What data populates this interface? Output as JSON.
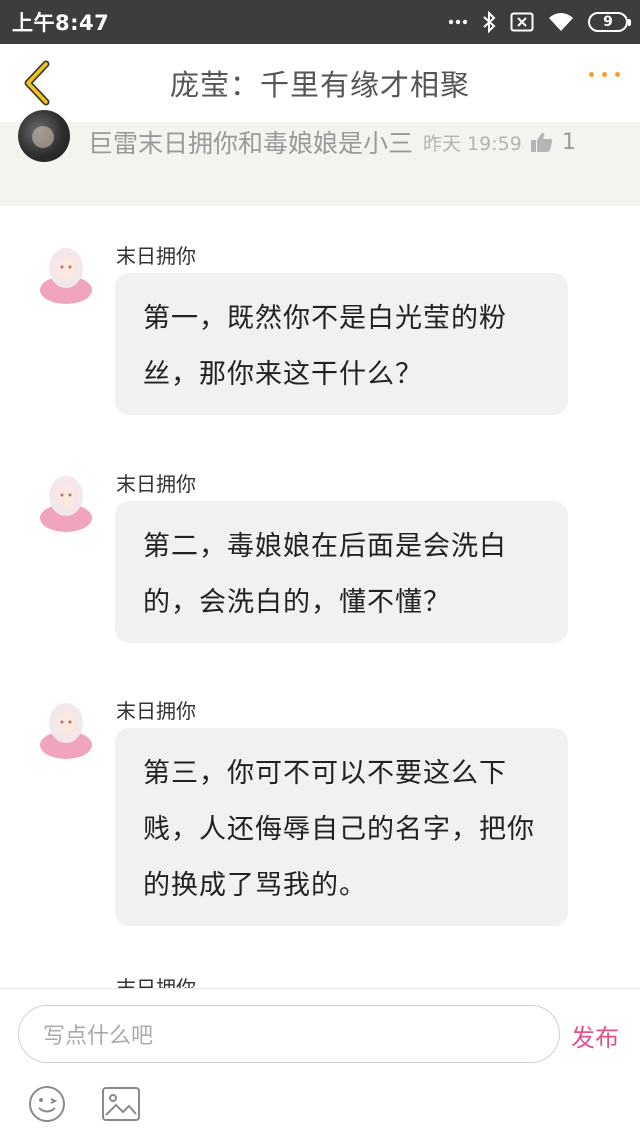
{
  "status_bar": {
    "time": "上午8:47",
    "battery": "9",
    "icons": [
      "signal-dots-icon",
      "bluetooth-icon",
      "sim-x-icon",
      "wifi-icon",
      "battery-icon"
    ]
  },
  "nav": {
    "title": "庞莹：千里有缘才相聚",
    "back_icon": "chevron-left-icon",
    "more_icon": "more-dots-icon",
    "accent": "#ff9a2e"
  },
  "quote": {
    "text": "巨雷末日拥你和毒娘娘是小三",
    "time": "昨天 19:59",
    "likes": "1",
    "like_icon": "thumbs-up-icon"
  },
  "messages": [
    {
      "user": "末日拥你",
      "text": "第一，既然你不是白光莹的粉丝，那你来这干什么？"
    },
    {
      "user": "末日拥你",
      "text": "第二，毒娘娘在后面是会洗白的，会洗白的，懂不懂？"
    },
    {
      "user": "末日拥你",
      "text": "第三，你可不可以不要这么下贱，人还侮辱自己的名字，把你的换成了骂我的。"
    },
    {
      "user": "末日拥你",
      "text": ""
    }
  ],
  "compose": {
    "placeholder": "写点什么吧",
    "publish_label": "发布",
    "publish_color": "#e8508a",
    "tools": [
      "emoji-icon",
      "image-icon"
    ]
  }
}
